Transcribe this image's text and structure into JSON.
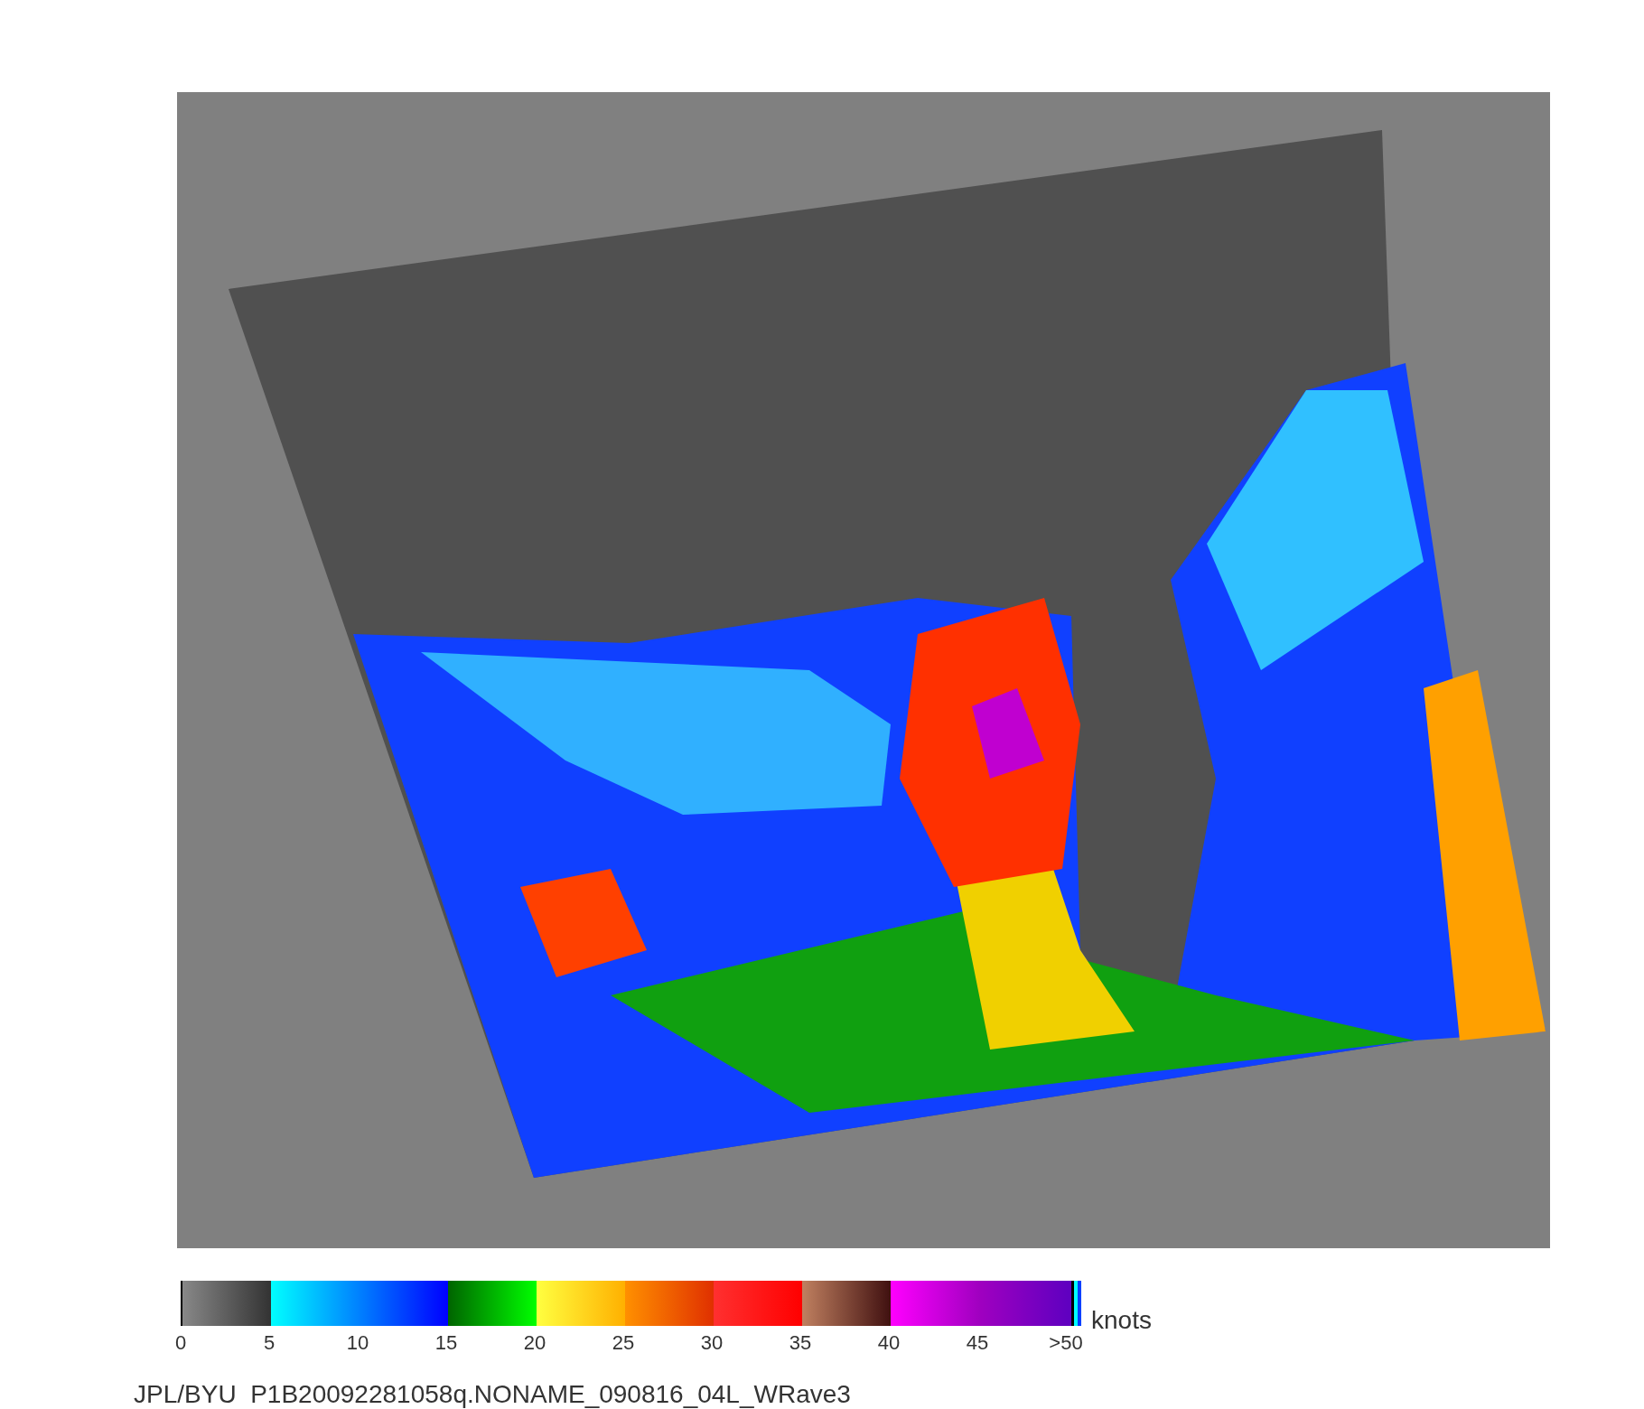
{
  "colorbar": {
    "unit": "knots",
    "ticks": [
      "0",
      "5",
      "10",
      "15",
      "20",
      "25",
      "30",
      "35",
      "40",
      "45",
      ">50"
    ]
  },
  "caption": "JPL/BYU  P1B20092281058q.NONAME_090816_04L_WRave3"
}
